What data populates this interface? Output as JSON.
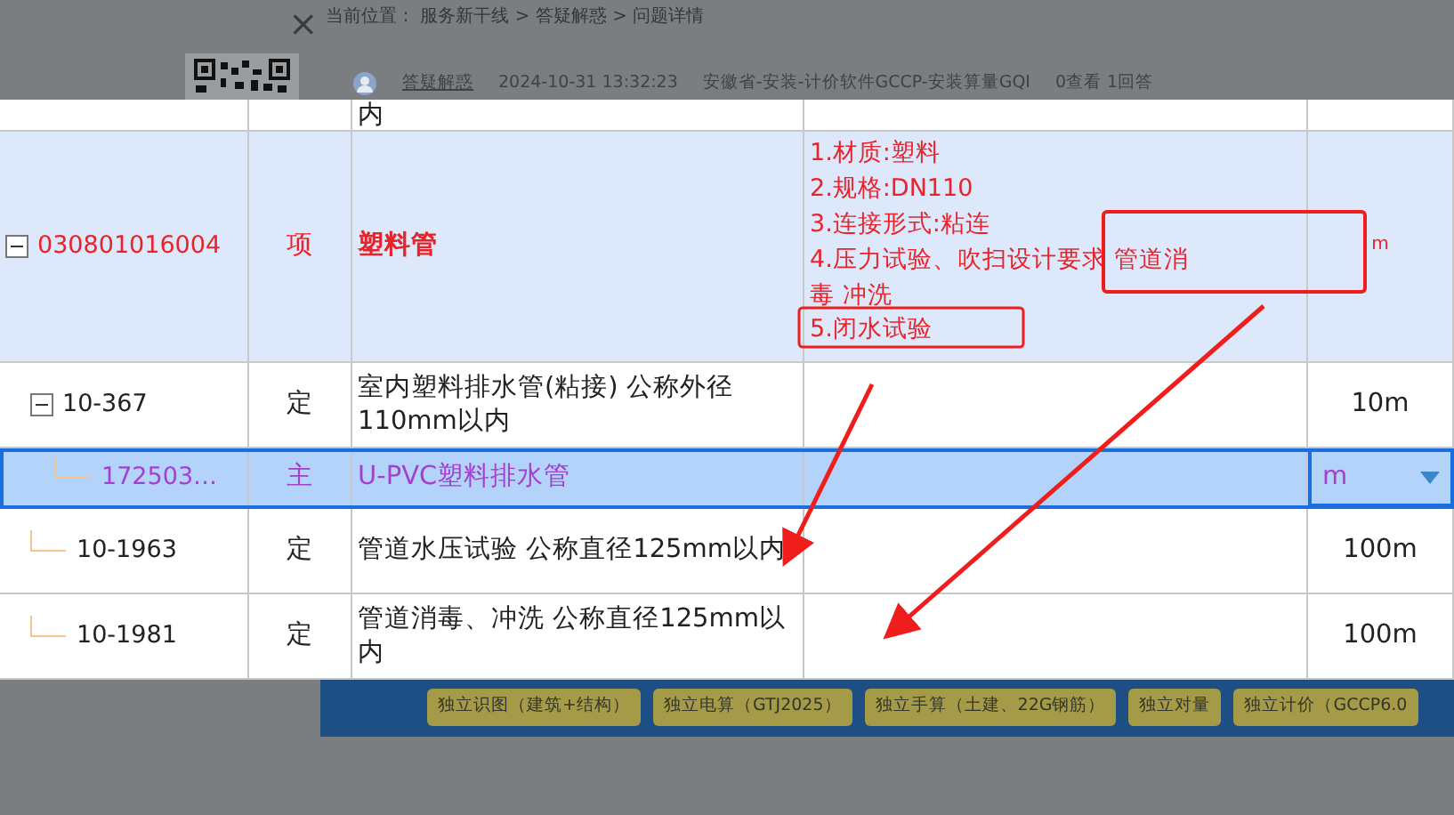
{
  "close": "×",
  "breadcrumb": {
    "label": "当前位置：",
    "path": "服务新干线 > 答疑解惑 > 问题详情"
  },
  "post_meta": {
    "category": "答疑解惑",
    "time": "2024-10-31 13:32:23",
    "tags": "安徽省-安装-计价软件GCCP-安装算量GQI",
    "stats": "0查看 1回答"
  },
  "table": {
    "rows": [
      {
        "kind": "partial",
        "name": "内",
        "selected": false
      },
      {
        "kind": "list",
        "code": "030801016004",
        "type": "项",
        "name": "塑料管",
        "features": [
          "1.材质:塑料",
          "2.规格:DN110",
          "3.连接形式:粘连",
          "4.压力试验、吹扫设计要求 管道消",
          "毒 冲洗",
          "5.闭水试验"
        ],
        "unit": "m",
        "expanded": true,
        "selected": false,
        "children": [
          {
            "kind": "quota",
            "code": "10-367",
            "type": "定",
            "name": "室内塑料排水管(粘接) 公称外径110mm以内",
            "unit": "10m",
            "expanded": true,
            "selected": false,
            "children": [
              {
                "kind": "material",
                "code": "172503…",
                "type": "主",
                "name": "U-PVC塑料排水管",
                "unit": "m",
                "selected": true
              }
            ]
          },
          {
            "kind": "quota",
            "code": "10-1963",
            "type": "定",
            "name": "管道水压试验 公称直径125mm以内",
            "unit": "100m",
            "selected": false
          },
          {
            "kind": "quota",
            "code": "10-1981",
            "type": "定",
            "name": "管道消毒、冲洗 公称直径125mm以内",
            "unit": "100m",
            "selected": false
          }
        ]
      }
    ]
  },
  "banner": {
    "buttons": [
      "独立识图（建筑+结构）",
      "独立电算（GTJ2025）",
      "独立手算（土建、22G钢筋）",
      "独立对量",
      "独立计价（GCCP6.0"
    ]
  }
}
